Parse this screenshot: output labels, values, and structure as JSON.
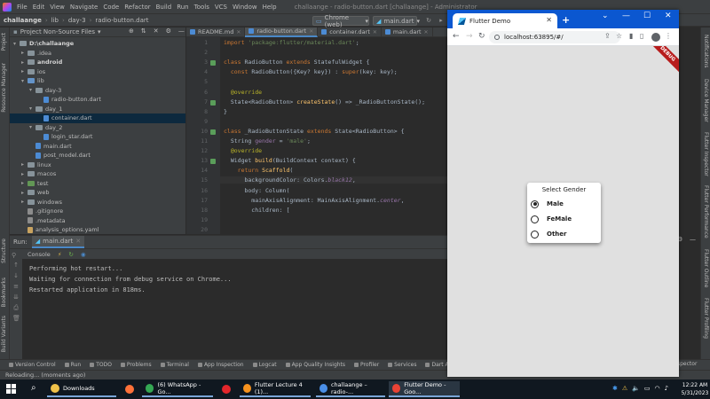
{
  "ide": {
    "menu": [
      "File",
      "Edit",
      "View",
      "Navigate",
      "Code",
      "Refactor",
      "Build",
      "Run",
      "Tools",
      "VCS",
      "Window",
      "Help"
    ],
    "window_title": "challaange - radio-button.dart [challaange] - Administrator",
    "breadcrumb": [
      "challaange",
      "lib",
      "day-3",
      "radio-button.dart"
    ],
    "device_selector": "Chrome (web)",
    "run_config": "main.dart",
    "project_panel_title": "Project Non-Source Files",
    "left_tabs": [
      "Project",
      "Resource Manager",
      "Structure",
      "Bookmarks",
      "Build Variants"
    ],
    "right_tabs": [
      "Notifications",
      "Device Manager",
      "Flutter Inspector",
      "Flutter Performance",
      "Flutter Outline",
      "Flutter Profiling"
    ],
    "tree": [
      {
        "label": "D:\\challaange",
        "indent": 0,
        "kind": "root",
        "arrow": "▾"
      },
      {
        "label": ".idea",
        "indent": 1,
        "kind": "folder",
        "arrow": "▸"
      },
      {
        "label": "android",
        "indent": 1,
        "kind": "folder-bold",
        "arrow": "▸"
      },
      {
        "label": "ios",
        "indent": 1,
        "kind": "folder",
        "arrow": "▸"
      },
      {
        "label": "lib",
        "indent": 1,
        "kind": "folder-blue",
        "arrow": "▾"
      },
      {
        "label": "day-3",
        "indent": 2,
        "kind": "folder",
        "arrow": "▾"
      },
      {
        "label": "radio-button.dart",
        "indent": 3,
        "kind": "file",
        "arrow": ""
      },
      {
        "label": "day_1",
        "indent": 2,
        "kind": "folder",
        "arrow": "▾"
      },
      {
        "label": "container.dart",
        "indent": 3,
        "kind": "file",
        "arrow": "",
        "selected": true
      },
      {
        "label": "day_2",
        "indent": 2,
        "kind": "folder",
        "arrow": "▾"
      },
      {
        "label": "login_star.dart",
        "indent": 3,
        "kind": "file",
        "arrow": ""
      },
      {
        "label": "main.dart",
        "indent": 2,
        "kind": "file",
        "arrow": ""
      },
      {
        "label": "post_model.dart",
        "indent": 2,
        "kind": "file",
        "arrow": ""
      },
      {
        "label": "linux",
        "indent": 1,
        "kind": "folder",
        "arrow": "▸"
      },
      {
        "label": "macos",
        "indent": 1,
        "kind": "folder",
        "arrow": "▸"
      },
      {
        "label": "test",
        "indent": 1,
        "kind": "folder-green",
        "arrow": "▸"
      },
      {
        "label": "web",
        "indent": 1,
        "kind": "folder",
        "arrow": "▸"
      },
      {
        "label": "windows",
        "indent": 1,
        "kind": "folder",
        "arrow": "▸"
      },
      {
        "label": ".gitignore",
        "indent": 1,
        "kind": "file-gray",
        "arrow": ""
      },
      {
        "label": ".metadata",
        "indent": 1,
        "kind": "file-gray",
        "arrow": ""
      },
      {
        "label": "analysis_options.yaml",
        "indent": 1,
        "kind": "file-yellow",
        "arrow": ""
      }
    ],
    "editor_tabs": [
      {
        "label": "README.md",
        "active": false
      },
      {
        "label": "radio-button.dart",
        "active": true
      },
      {
        "label": "container.dart",
        "active": false
      },
      {
        "label": "main.dart",
        "active": false
      }
    ],
    "code_lines": [
      {
        "n": "1",
        "html": "<span class='kw'>import</span> <span class='str'>'package:flutter/material.dart'</span>;"
      },
      {
        "n": "2",
        "html": ""
      },
      {
        "n": "3",
        "html": "<span class='kw'>class</span> RadioButton <span class='kw'>extends</span> StatefulWidget {"
      },
      {
        "n": "4",
        "html": "  <span class='kw'>const</span> RadioButton({Key? key}) : <span class='kw'>super</span>(key: key);"
      },
      {
        "n": "5",
        "html": ""
      },
      {
        "n": "6",
        "html": "  <span class='ann'>@override</span>"
      },
      {
        "n": "7",
        "html": "  State&lt;RadioButton&gt; <span class='fn'>createState</span>() =&gt; _RadioButtonState();"
      },
      {
        "n": "8",
        "html": "}"
      },
      {
        "n": "9",
        "html": ""
      },
      {
        "n": "10",
        "html": "<span class='kw'>class</span> _RadioButtonState <span class='kw'>extends</span> State&lt;RadioButton&gt; {"
      },
      {
        "n": "11",
        "html": "  String <span class='prop'>gender</span> = <span class='str'>'male'</span>;"
      },
      {
        "n": "12",
        "html": "  <span class='ann'>@override</span>"
      },
      {
        "n": "13",
        "html": "  Widget <span class='fn'>build</span>(BuildContext context) {"
      },
      {
        "n": "14",
        "html": "    <span class='kw'>return</span> <span class='fn'>Scaffold</span>("
      },
      {
        "n": "15",
        "html": "      backgroundColor: Colors.<span class='it'>black12</span>,",
        "highlight": true
      },
      {
        "n": "16",
        "html": "      body: Column("
      },
      {
        "n": "17",
        "html": "        mainAxisAlignment: MainAxisAlignment.<span class='it'>center</span>,"
      },
      {
        "n": "18",
        "html": "        children: ["
      },
      {
        "n": "19",
        "html": ""
      },
      {
        "n": "20",
        "html": ""
      }
    ],
    "run_label": "Run:",
    "run_tab": "main.dart",
    "console_label": "Console",
    "console_lines": [
      "Performing hot restart...",
      "Waiting for connection from debug service on Chrome...",
      "Restarted application in 818ms."
    ],
    "bottom_tools": [
      "Version Control",
      "Run",
      "TODO",
      "Problems",
      "Terminal",
      "App Inspection",
      "Logcat",
      "App Quality Insights",
      "Profiler",
      "Services",
      "Dart Analysis"
    ],
    "status_text": "Reloading... (moments ago)",
    "right_fragment": "spector"
  },
  "browser": {
    "tab_title": "Flutter Demo",
    "url": "localhost:63895/#/",
    "debug_banner": "DEBUG",
    "dialog": {
      "title": "Select Gender",
      "options": [
        {
          "label": "Male",
          "selected": true
        },
        {
          "label": "FeMale",
          "selected": false
        },
        {
          "label": "Other",
          "selected": false
        }
      ]
    }
  },
  "taskbar": {
    "items": [
      {
        "label": "Downloads",
        "color": "#f0c24a",
        "open": true
      },
      {
        "label": "",
        "color": "#ff7139",
        "open": false
      },
      {
        "label": "(6) WhatsApp - Go...",
        "color": "#34a853",
        "open": true
      },
      {
        "label": "",
        "color": "#e3262b",
        "open": false
      },
      {
        "label": "Flutter Lecture 4 (1)...",
        "color": "#f7931e",
        "open": true
      },
      {
        "label": "challaange – radio-...",
        "color": "#4a8fe7",
        "open": true
      },
      {
        "label": "Flutter Demo - Goo...",
        "color": "#ea4335",
        "open": true,
        "active": true
      }
    ],
    "time": "12:22 AM",
    "date": "5/31/2023"
  }
}
